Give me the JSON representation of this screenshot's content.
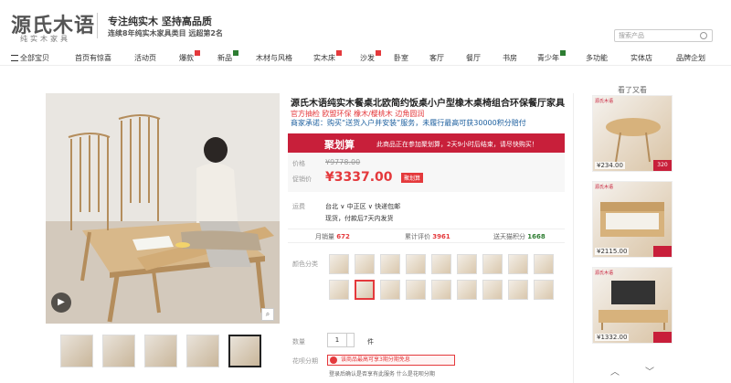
{
  "header": {
    "logo_text": "源氏木语",
    "logo_sub": "纯实木家具",
    "slogan_main": "专注纯实木 坚持高品质",
    "slogan_sub": "连续8年纯实木家具类目 远超第2名",
    "search_placeholder": "搜索产品"
  },
  "nav": {
    "items": [
      {
        "label": "全部宝贝",
        "badge": false
      },
      {
        "label": "首页有惊喜",
        "badge": false
      },
      {
        "label": "活动页",
        "badge": false
      },
      {
        "label": "爆款",
        "badge": true
      },
      {
        "label": "新品",
        "badge": true
      },
      {
        "label": "木材与风格",
        "badge": false
      },
      {
        "label": "实木床",
        "badge": true
      },
      {
        "label": "沙发",
        "badge": true
      },
      {
        "label": "卧室",
        "badge": false
      },
      {
        "label": "客厅",
        "badge": false
      },
      {
        "label": "餐厅",
        "badge": false
      },
      {
        "label": "书房",
        "badge": false
      },
      {
        "label": "青少年",
        "badge": true
      },
      {
        "label": "多功能",
        "badge": false
      },
      {
        "label": "实体店",
        "badge": false
      },
      {
        "label": "品牌企划",
        "badge": false
      }
    ]
  },
  "product": {
    "title": "源氏木语纯实木餐桌北欧简约饭桌小户型橡木桌椅组合环保餐厅家具",
    "subtitle1": "官方抽检 欧盟环保 橡木/樱桃木 边角圆润",
    "subtitle2": "商家承诺：购买“送货入户并安装”服务，未履行最高可获30000积分赔付",
    "promo_logo": "聚划算",
    "promo_text": "此商品正在参加聚划算，2天9小时后结束，请尽快购买！",
    "old_price_label": "价格",
    "old_price": "¥9778.00",
    "new_price_label": "促销价",
    "new_price": "¥3337.00",
    "price_tag": "聚划算",
    "ship_label": "运费",
    "ship_location": "台北 ∨ 中正区 ∨  快递包邮",
    "ship_stock": "现货，付款后7天内发货",
    "stats": [
      {
        "label": "月销量",
        "value": "672"
      },
      {
        "label": "累计评价",
        "value": "3961"
      },
      {
        "label": "送天猫积分",
        "value": "1668"
      }
    ],
    "color_label": "颜色分类",
    "qty_label": "数量",
    "qty_value": "1",
    "qty_unit": "件",
    "huabei_label": "花呗分期",
    "huabei_text": "该商品最高可享3期分期免息",
    "huabei_note": "登录后确认是否享有此服务  什么是花呗分期"
  },
  "recommend": {
    "heading": "看了又看",
    "items": [
      {
        "price": "¥234.00",
        "brand": "源氏木语"
      },
      {
        "price": "¥2115.00",
        "brand": "源氏木语"
      },
      {
        "price": "¥1332.00",
        "brand": "源氏木语"
      }
    ]
  },
  "icons": {
    "play": "play-icon",
    "zoom": "zoom-icon",
    "search": "search-icon",
    "menu": "menu-icon"
  },
  "colors": {
    "accent": "#e4393c",
    "promo": "#c81f3a"
  }
}
